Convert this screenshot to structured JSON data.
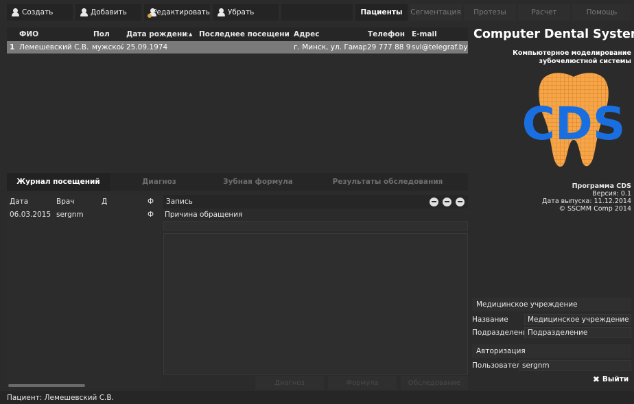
{
  "toolbar": {
    "create": "Создать",
    "add": "Добавить",
    "edit": "Редактировать",
    "remove": "Убрать"
  },
  "top_tabs": [
    "Пациенты",
    "Сегментация",
    "Протезы",
    "Расчет",
    "Помощь"
  ],
  "patients": {
    "columns": {
      "num": "",
      "name": "ФИО",
      "sex": "Пол",
      "dob": "Дата рождения",
      "sort_glyph": "▲",
      "last_visit": "Последнее посещение",
      "address": "Адрес",
      "phone": "Телефон",
      "email": "E-mail"
    },
    "rows": [
      {
        "num": "1",
        "name": "Лемешевский С.В.",
        "sex": "мужской",
        "dob": "25.09.1974",
        "last_visit": "",
        "address": "г. Минск, ул. Гамар…",
        "phone": "29 777 88 99",
        "email": "svl@telegraf.by"
      }
    ]
  },
  "lower_tabs": [
    "Журнал посещений",
    "Диагноз",
    "Зубная формула",
    "Результаты обследования"
  ],
  "visits": {
    "columns": {
      "date": "Дата",
      "doctor": "Врач",
      "d": "Д",
      "f": "Ф"
    },
    "rows": [
      {
        "date": "06.03.2015",
        "doctor": "sergnm",
        "d": "",
        "f": "Ф"
      }
    ]
  },
  "record": {
    "header": "Запись",
    "reason_label": "Причина обращения"
  },
  "bottom_buttons": [
    "Диагноз",
    "Формула",
    "Обследование"
  ],
  "status_bar": "Пациент: Лемешевский С.В.",
  "about": {
    "title": "Computer Dental System",
    "subtitle_line1": "Компьютерное моделирование",
    "subtitle_line2": "зубочелюстной системы",
    "logo_text": "CDS",
    "program": "Программа CDS",
    "version": "Версия: 0.1",
    "release": "Дата выпуска: 11.12.2014",
    "copyright": "© SSCMM Comp 2014"
  },
  "institution": {
    "header": "Медицинское учреждение",
    "name_label": "Название",
    "name_value": "Медицинское учреждение",
    "dept_label": "Подразделение",
    "dept_value": "Подразделение"
  },
  "auth": {
    "header": "Авторизация",
    "user_label": "Пользователь",
    "user_value": "sergnm"
  },
  "exit_label": "Выйти",
  "colors": {
    "background": "#2b2b2b",
    "selected_row": "#7a7a7a",
    "logo_blue": "#1a6fe0",
    "tooth_orange": "#f0a040"
  }
}
